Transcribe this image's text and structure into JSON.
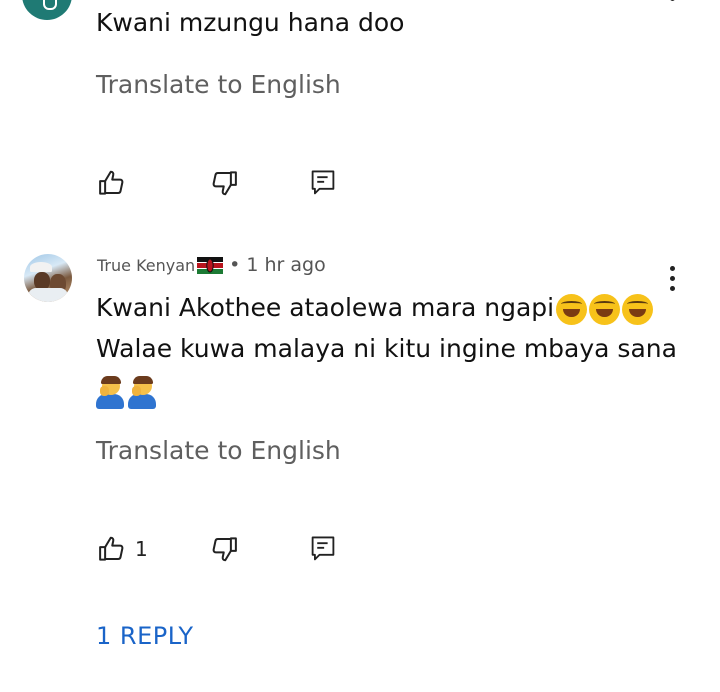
{
  "comment1": {
    "text": "Kwani mzungu hana doo",
    "translate_label": "Translate to English"
  },
  "comment2": {
    "author": "True Kenyan",
    "separator": "•",
    "time": "1 hr ago",
    "line1": "Kwani Akothee ataolewa mara ngapi",
    "line2": "Walae kuwa malaya ni kitu ingine mbaya sana",
    "translate_label": "Translate to English",
    "like_count": "1",
    "reply_label": "1 REPLY"
  },
  "icons": [
    "thumbs-up-icon",
    "thumbs-down-icon",
    "reply-icon",
    "more-vert-icon",
    "kenya-flag-icon",
    "tears-of-joy-emoji",
    "facepalm-emoji"
  ],
  "colors": {
    "text": "#111111",
    "muted": "#5f5f5f",
    "link": "#1a64c8",
    "avatar_top": "#1f7a74"
  }
}
